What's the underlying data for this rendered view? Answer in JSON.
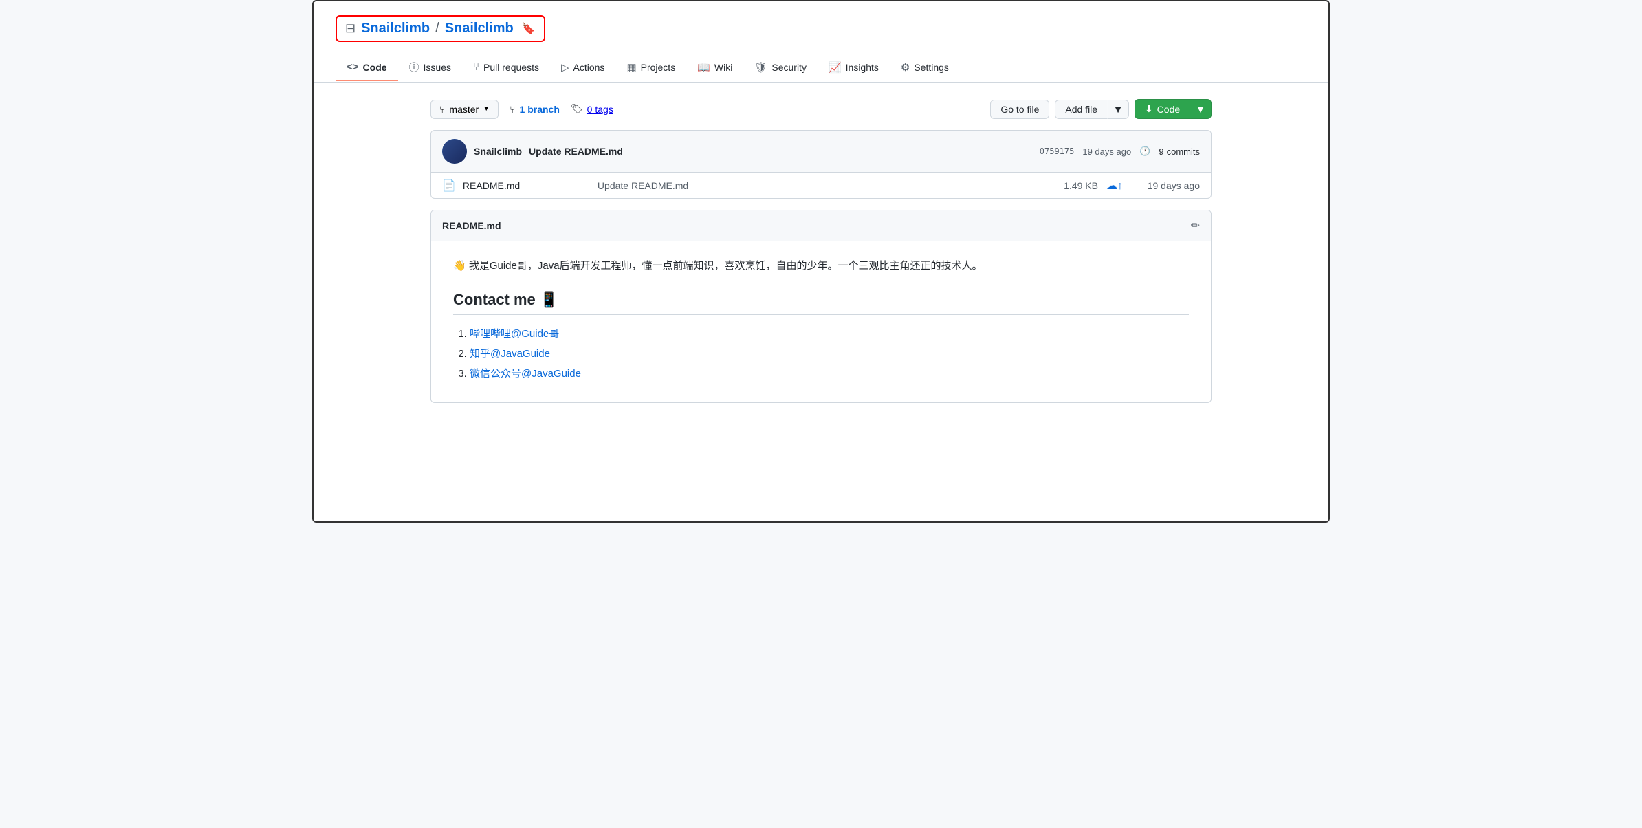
{
  "repo": {
    "owner": "Snailclimb",
    "separator": "/",
    "name": "Snailclimb"
  },
  "nav": {
    "tabs": [
      {
        "id": "code",
        "label": "Code",
        "icon": "<>",
        "active": true
      },
      {
        "id": "issues",
        "label": "Issues",
        "icon": "ⓘ",
        "active": false
      },
      {
        "id": "pull-requests",
        "label": "Pull requests",
        "icon": "⑂",
        "active": false
      },
      {
        "id": "actions",
        "label": "Actions",
        "icon": "▷",
        "active": false
      },
      {
        "id": "projects",
        "label": "Projects",
        "icon": "▦",
        "active": false
      },
      {
        "id": "wiki",
        "label": "Wiki",
        "icon": "📖",
        "active": false
      },
      {
        "id": "security",
        "label": "Security",
        "icon": "🛡",
        "active": false
      },
      {
        "id": "insights",
        "label": "Insights",
        "icon": "📈",
        "active": false
      },
      {
        "id": "settings",
        "label": "Settings",
        "icon": "⚙",
        "active": false
      }
    ]
  },
  "branch": {
    "name": "master",
    "branch_count": "1",
    "branch_label": "branch",
    "tag_count": "0",
    "tag_label": "tags"
  },
  "toolbar": {
    "go_to_file": "Go to file",
    "add_file": "Add file",
    "code": "Code"
  },
  "commit": {
    "author": "Snailclimb",
    "message": "Update README.md",
    "hash": "0759175",
    "time": "19 days ago",
    "commits_count": "9",
    "commits_label": "commits"
  },
  "files": [
    {
      "icon": "📄",
      "name": "README.md",
      "commit_msg": "Update README.md",
      "size": "1.49 KB",
      "date": "19 days ago"
    }
  ],
  "readme": {
    "title": "README.md",
    "intro": "👋 我是Guide哥，Java后端开发工程师，懂一点前端知识，喜欢烹饪，自由的少年。一个三观比主角还正的技术人。",
    "contact_heading": "Contact me 📱",
    "contact_links": [
      {
        "text": "哔哩哔哩@Guide哥",
        "url": "#"
      },
      {
        "text": "知乎@JavaGuide",
        "url": "#"
      },
      {
        "text": "微信公众号@JavaGuide",
        "url": "#"
      }
    ]
  }
}
